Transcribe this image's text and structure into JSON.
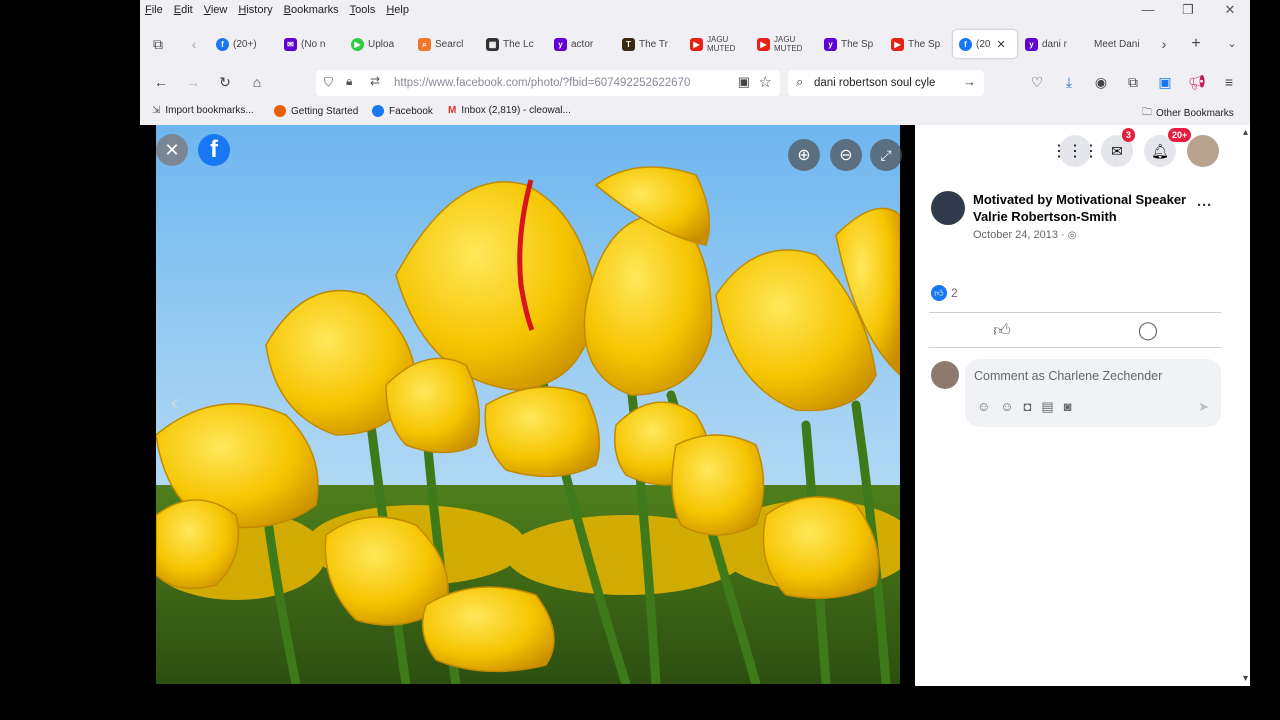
{
  "menu": [
    "File",
    "Edit",
    "View",
    "History",
    "Bookmarks",
    "Tools",
    "Help"
  ],
  "tabs": [
    {
      "title": "(20+)",
      "color": "#1877f2",
      "glyph": "f"
    },
    {
      "title": "(No n",
      "color": "#6001d2",
      "glyph": "✉"
    },
    {
      "title": "Uploa",
      "color": "#2ecc40",
      "glyph": "▶"
    },
    {
      "title": "Searcl",
      "color": "#f0782d",
      "glyph": "⌕"
    },
    {
      "title": "The Lc",
      "color": "#333333",
      "glyph": "▦"
    },
    {
      "title": "actor",
      "color": "#6001d2",
      "glyph": "y"
    },
    {
      "title": "The Tr",
      "color": "#3b2a12",
      "glyph": "T"
    },
    {
      "title": "JAGU MUTED",
      "color": "#e62117",
      "glyph": "▶"
    },
    {
      "title": "JAGU MUTED",
      "color": "#e62117",
      "glyph": "▶"
    },
    {
      "title": "The Sp",
      "color": "#6001d2",
      "glyph": "y"
    },
    {
      "title": "The Sp",
      "color": "#e62117",
      "glyph": "▶"
    },
    {
      "title": "(20",
      "color": "#1877f2",
      "glyph": "f"
    },
    {
      "title": "dani r",
      "color": "#6001d2",
      "glyph": "y"
    },
    {
      "title": "Meet Dani",
      "color": "",
      "glyph": ""
    }
  ],
  "url": "https://www.facebook.com/photo/?fbid=607492252622670",
  "search_query": "dani robertson soul cyle",
  "bookmarks": [
    {
      "label": "Import bookmarks...",
      "color": "#777777"
    },
    {
      "label": "Getting Started",
      "color": "#e66000"
    },
    {
      "label": "Facebook",
      "color": "#1877f2"
    },
    {
      "label": "Inbox (2,819) - cleowal...",
      "color": "#d93025"
    }
  ],
  "other_bookmarks": "Other Bookmarks",
  "notifications": {
    "messenger_badge": "3",
    "bell_badge": "20+"
  },
  "post": {
    "author": "Motivated by Motivational Speaker Valrie Robertson-Smith",
    "date": "October 24, 2013",
    "reactions": "2"
  },
  "comment_placeholder": "Comment as Charlene Zechender",
  "colors": {
    "facebook_blue": "#1877f2",
    "badge_red": "#e41e3f"
  }
}
